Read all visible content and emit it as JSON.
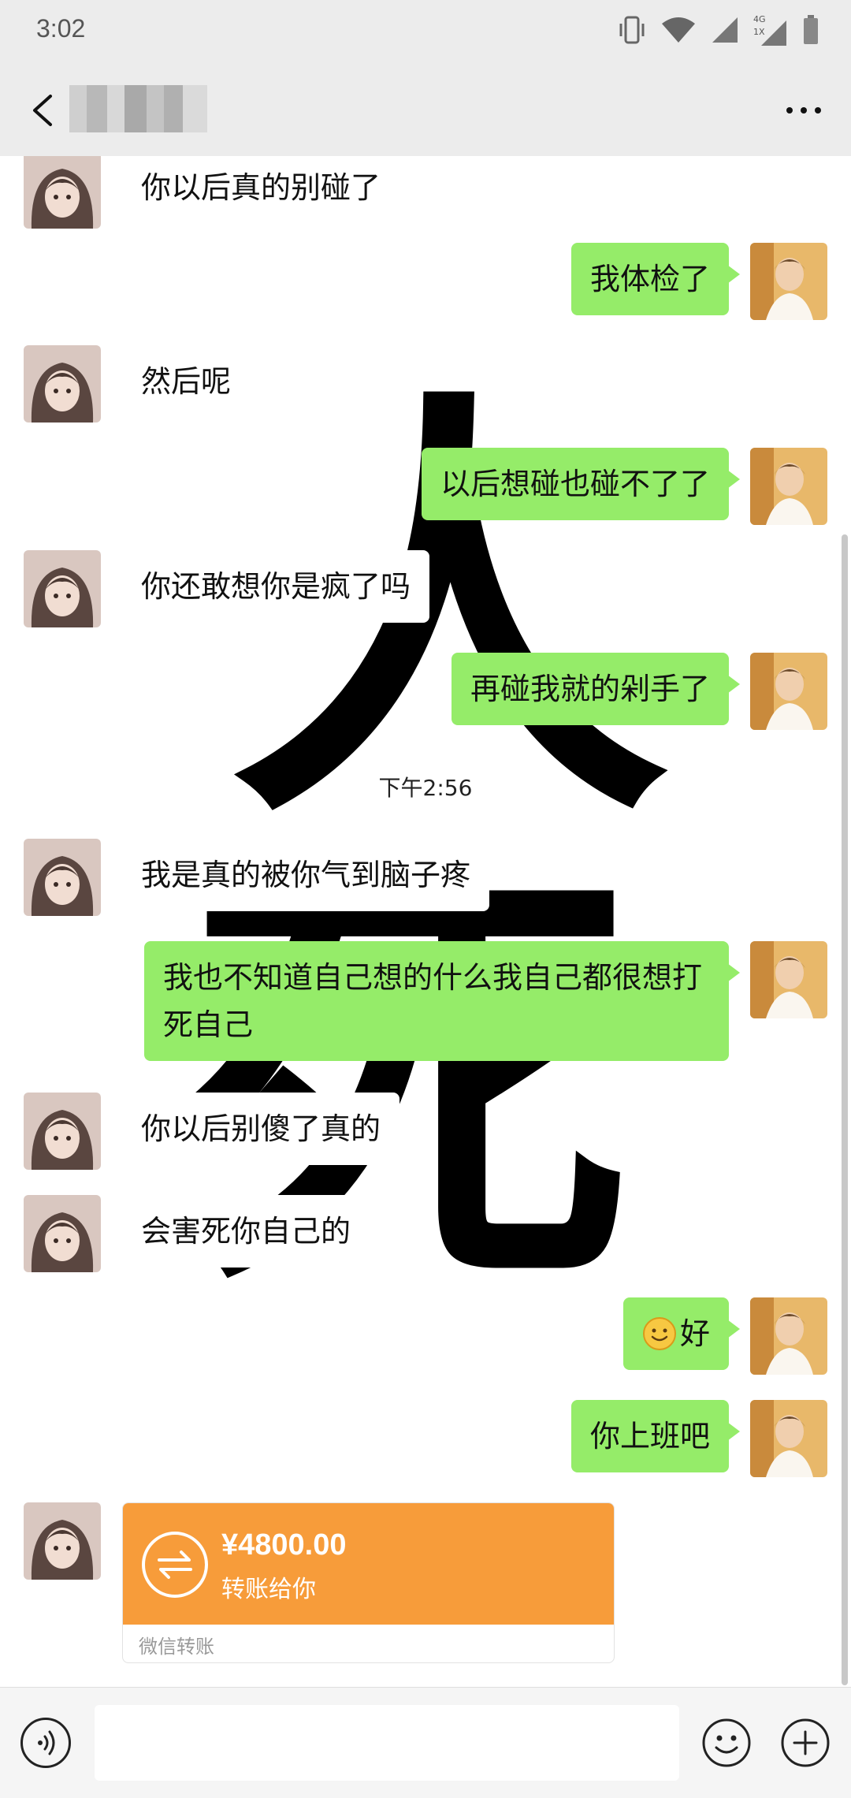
{
  "status_bar": {
    "time": "3:02",
    "network_label_top": "4G",
    "network_label_bottom": "1X"
  },
  "header": {
    "contact_name": "",
    "back_icon": "chevron-left-icon",
    "more_icon": "more-dots-icon"
  },
  "background": {
    "calligraphy_top": "人",
    "calligraphy_bottom": "死"
  },
  "messages": [
    {
      "side": "left",
      "text": "你以后真的别碰了"
    },
    {
      "side": "right",
      "text": "我体检了"
    },
    {
      "side": "left",
      "text": "然后呢"
    },
    {
      "side": "right",
      "text": "以后想碰也碰不了了"
    },
    {
      "side": "left",
      "text": "你还敢想你是疯了吗"
    },
    {
      "side": "right",
      "text": "再碰我就的剁手了"
    },
    {
      "side": "left",
      "text": "我是真的被你气到脑子疼"
    },
    {
      "side": "right",
      "text": "我也不知道自己想的什么我自己都很想打死自己"
    },
    {
      "side": "left",
      "text": "你以后别傻了真的"
    },
    {
      "side": "left",
      "text": "会害死你自己的"
    },
    {
      "side": "right",
      "text": "好",
      "emoji": "smile-emoji-icon"
    },
    {
      "side": "right",
      "text": "你上班吧"
    }
  ],
  "timestamp": "下午2:56",
  "transfer": {
    "amount": "¥4800.00",
    "subtitle": "转账给你",
    "footer": "微信转账",
    "color": "#f79c3a"
  },
  "input_bar": {
    "placeholder": "",
    "voice_icon": "voice-icon",
    "emoji_icon": "emoji-icon",
    "plus_icon": "plus-icon"
  },
  "colors": {
    "right_bubble": "#95ec69",
    "left_bubble": "#ffffff",
    "bar_bg": "#ececec"
  }
}
